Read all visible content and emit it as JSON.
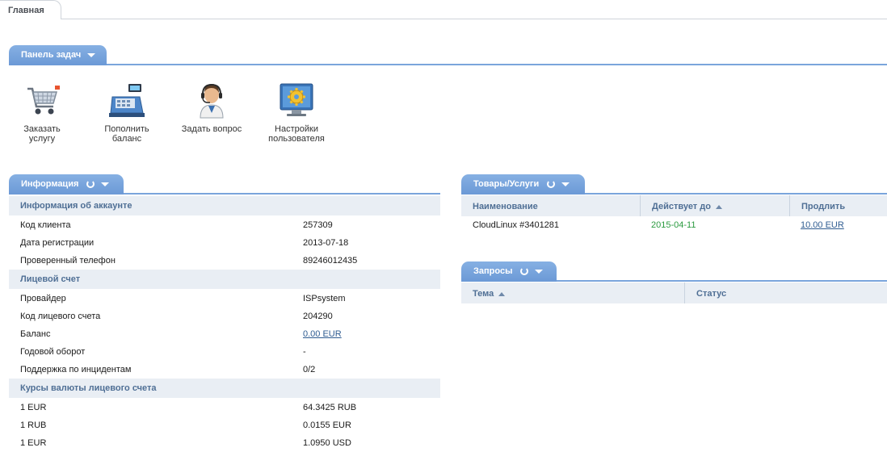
{
  "top_tab": "Главная",
  "taskbar": {
    "title": "Панель задач",
    "items": [
      {
        "label_line1": "Заказать",
        "label_line2": "услугу",
        "icon": "cart-icon"
      },
      {
        "label_line1": "Пополнить",
        "label_line2": "баланс",
        "icon": "cash-register-icon"
      },
      {
        "label_line1": "Задать вопрос",
        "label_line2": "",
        "icon": "support-operator-icon"
      },
      {
        "label_line1": "Настройки",
        "label_line2": "пользователя",
        "icon": "settings-monitor-icon"
      }
    ]
  },
  "info": {
    "title": "Информация",
    "account_group": "Информация об аккаунте",
    "account": [
      {
        "key": "Код клиента",
        "value": "257309"
      },
      {
        "key": "Дата регистрации",
        "value": "2013-07-18"
      },
      {
        "key": "Проверенный телефон",
        "value": "89246012435"
      }
    ],
    "personal_group": "Лицевой счет",
    "personal": [
      {
        "key": "Провайдер",
        "value": "ISPsystem"
      },
      {
        "key": "Код лицевого счета",
        "value": "204290"
      },
      {
        "key": "Баланс",
        "value": "0.00 EUR"
      },
      {
        "key": "Годовой оборот",
        "value": "-"
      },
      {
        "key": "Поддержка по инцидентам",
        "value": "0/2"
      }
    ],
    "rates_group": "Курсы валюты лицевого счета",
    "rates": [
      {
        "key": "1 EUR",
        "value": "64.3425 RUB"
      },
      {
        "key": "1 RUB",
        "value": "0.0155 EUR"
      },
      {
        "key": "1 EUR",
        "value": "1.0950 USD"
      }
    ]
  },
  "services": {
    "title": "Товары/Услуги",
    "columns": [
      "Наименование",
      "Действует до",
      "Продлить"
    ],
    "rows": [
      {
        "name": "CloudLinux #3401281",
        "expires": "2015-04-11",
        "renew": "10.00 EUR"
      }
    ]
  },
  "requests": {
    "title": "Запросы",
    "columns": [
      "Тема",
      "Статус"
    ]
  },
  "colors": {
    "accent": "#6b99d6",
    "group_bg": "#e9eef4",
    "link": "#2f5c91",
    "status_green": "#2a9a3f"
  }
}
